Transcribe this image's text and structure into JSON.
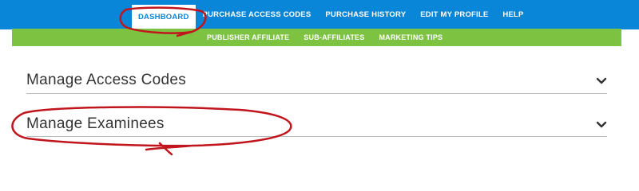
{
  "top_nav": {
    "items": [
      {
        "label": "DASHBOARD",
        "active": true
      },
      {
        "label": "PURCHASE ACCESS CODES",
        "active": false
      },
      {
        "label": "PURCHASE HISTORY",
        "active": false
      },
      {
        "label": "EDIT MY PROFILE",
        "active": false
      },
      {
        "label": "HELP",
        "active": false
      }
    ]
  },
  "sub_nav": {
    "items": [
      {
        "label": "PUBLISHER AFFILIATE"
      },
      {
        "label": "SUB-AFFILIATES"
      },
      {
        "label": "MARKETING TIPS"
      }
    ]
  },
  "sections": [
    {
      "title": "Manage Access Codes",
      "icon": "chevron-down-icon"
    },
    {
      "title": "Manage Examinees",
      "icon": "chevron-down-icon"
    }
  ],
  "colors": {
    "nav_blue": "#0a86d8",
    "subnav_green": "#7dc241",
    "annotation_red": "#c0151c"
  }
}
